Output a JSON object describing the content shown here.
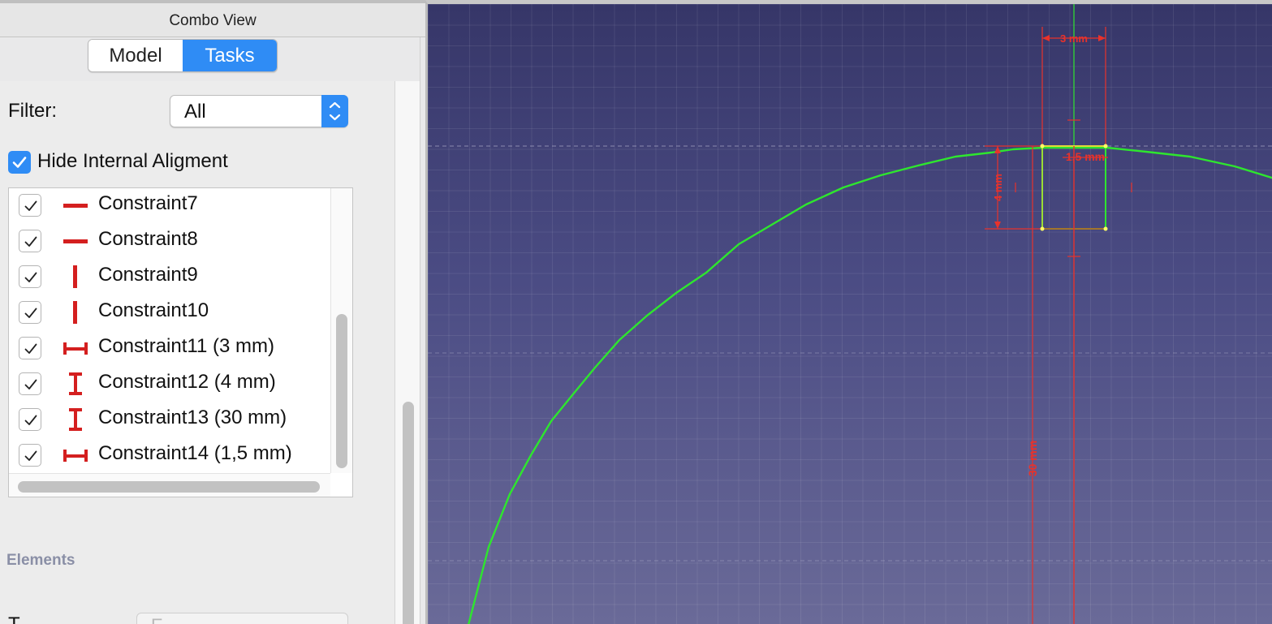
{
  "panel": {
    "title": "Combo View",
    "tabs": [
      {
        "label": "Model",
        "active": false
      },
      {
        "label": "Tasks",
        "active": true
      }
    ]
  },
  "filter": {
    "label": "Filter:",
    "value": "All"
  },
  "hide_internal": {
    "label": "Hide Internal Aligment",
    "checked": true
  },
  "constraints": [
    {
      "label": "Constraint7",
      "icon": "horizontal-constraint-icon",
      "checked": true
    },
    {
      "label": "Constraint8",
      "icon": "horizontal-constraint-icon",
      "checked": true
    },
    {
      "label": "Constraint9",
      "icon": "vertical-constraint-icon",
      "checked": true
    },
    {
      "label": "Constraint10",
      "icon": "vertical-constraint-icon",
      "checked": true
    },
    {
      "label": "Constraint11 (3 mm)",
      "icon": "horizontal-distance-icon",
      "checked": true
    },
    {
      "label": "Constraint12 (4 mm)",
      "icon": "vertical-distance-icon",
      "checked": true
    },
    {
      "label": "Constraint13 (30 mm)",
      "icon": "vertical-distance-icon",
      "checked": true
    },
    {
      "label": "Constraint14 (1,5 mm)",
      "icon": "horizontal-distance-icon",
      "checked": true
    }
  ],
  "elements_section": {
    "label": "Elements"
  },
  "bottom_row": {
    "label": "T",
    "value": "E"
  },
  "viewport": {
    "dimension_labels": {
      "width_3": "3 mm",
      "width_1_5": "1,5 mm",
      "height_4": "4 mm",
      "height_30": "30 mm"
    },
    "colors": {
      "background_top": "#363668",
      "background_bottom": "#6a6a98",
      "geometry": "#2ee62e",
      "constraint": "#e8322b",
      "accent": "#2f8cf5"
    }
  }
}
